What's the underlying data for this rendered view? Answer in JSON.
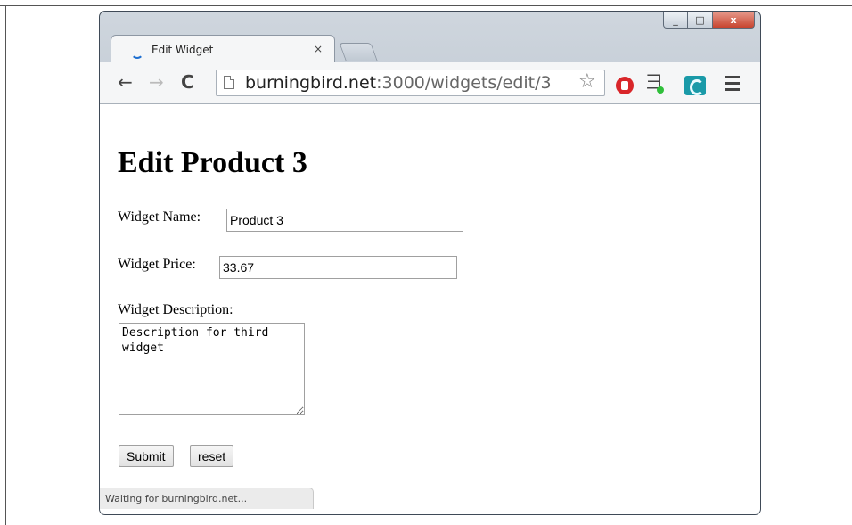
{
  "window": {
    "controls": {
      "minimize": "_",
      "maximize": "□",
      "close": "x"
    }
  },
  "tab": {
    "title": "Edit Widget",
    "close_glyph": "×"
  },
  "toolbar": {
    "back_glyph": "←",
    "forward_glyph": "→",
    "reload_glyph": "C",
    "url_host": "burningbird.net",
    "url_rest": ":3000/widgets/edit/3",
    "bookmark_glyph": "☆",
    "icons": [
      "back-arrow-icon",
      "forward-arrow-icon",
      "reload-icon",
      "page-icon",
      "bookmark-star-icon",
      "stop-extension-icon",
      "developer-extension-icon",
      "wave-extension-icon",
      "menu-icon"
    ]
  },
  "page": {
    "heading": "Edit Product 3",
    "name_label": "Widget Name:",
    "name_value": "Product 3",
    "price_label": "Widget Price:",
    "price_value": "33.67",
    "description_label": "Widget Description:",
    "description_value": "Description for third widget",
    "submit_label": "Submit",
    "reset_label": "reset"
  },
  "status": {
    "text": "Waiting for burningbird.net..."
  }
}
